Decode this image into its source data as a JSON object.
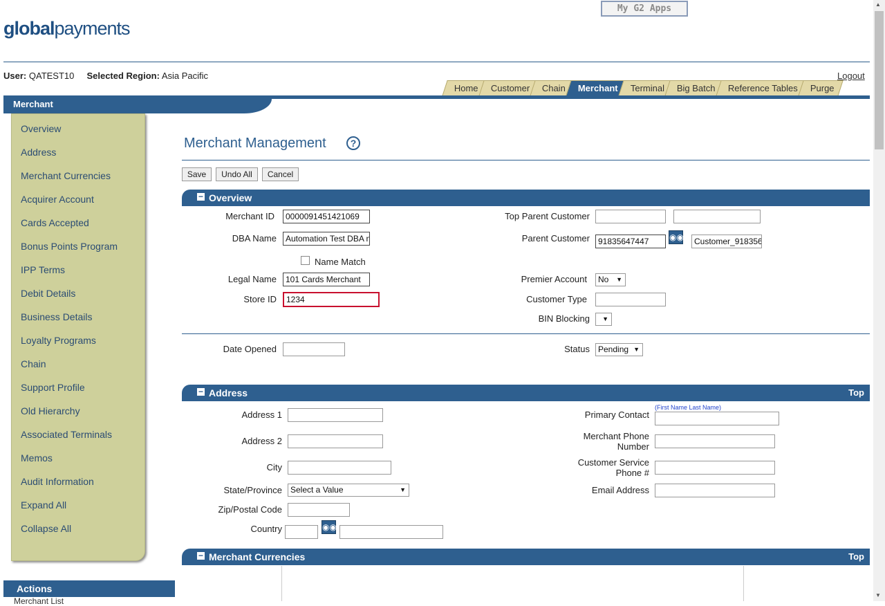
{
  "header": {
    "apps_button": "My G2 Apps",
    "logo_bold": "global",
    "logo_light": "payments",
    "user_label": "User:",
    "user_value": "QATEST10",
    "region_label": "Selected Region:",
    "region_value": "Asia Pacific",
    "logout": "Logout"
  },
  "tabs": [
    "Home",
    "Customer",
    "Chain",
    "Merchant",
    "Terminal",
    "Big Batch",
    "Reference Tables",
    "Purge"
  ],
  "active_tab": "Merchant",
  "subnav_title": "Merchant",
  "sidebar": {
    "items": [
      "Overview",
      "Address",
      "Merchant Currencies",
      "Acquirer Account",
      "Cards Accepted",
      "Bonus Points Program",
      "IPP Terms",
      "Debit Details",
      "Business Details",
      "Loyalty Programs",
      "Chain",
      "Support Profile",
      "Old Hierarchy",
      "Associated Terminals",
      "Memos",
      "Audit Information",
      "Expand All",
      "Collapse All"
    ]
  },
  "actions": {
    "title": "Actions",
    "first_item": "Merchant List"
  },
  "page": {
    "title": "Merchant Management",
    "help": "?",
    "buttons": {
      "save": "Save",
      "undo": "Undo All",
      "cancel": "Cancel"
    }
  },
  "overview": {
    "title": "Overview",
    "merchant_id_label": "Merchant ID",
    "merchant_id": "0000091451421069",
    "dba_label": "DBA Name",
    "dba": "Automation Test DBA n",
    "name_match_label": "Name Match",
    "legal_label": "Legal Name",
    "legal": "101 Cards Merchant",
    "store_label": "Store ID",
    "store": "1234",
    "top_parent_label": "Top Parent Customer",
    "top_parent": "",
    "top_parent_name": "",
    "parent_label": "Parent Customer",
    "parent": "91835647447",
    "parent_name": "Customer_918356",
    "premier_label": "Premier Account",
    "premier": "No",
    "customer_type_label": "Customer Type",
    "customer_type": "",
    "bin_label": "BIN Blocking",
    "bin": "",
    "date_opened_label": "Date Opened",
    "date_opened": "",
    "status_label": "Status",
    "status": "Pending"
  },
  "address": {
    "title": "Address",
    "top": "Top",
    "address1_label": "Address 1",
    "address1": "",
    "address2_label": "Address 2",
    "address2": "",
    "city_label": "City",
    "city": "",
    "state_label": "State/Province",
    "state": "Select a Value",
    "zip_label": "Zip/Postal Code",
    "zip": "",
    "country_label": "Country",
    "country_code": "",
    "country_name": "",
    "primary_contact_label": "Primary Contact",
    "primary_contact_hint": "(First Name Last Name)",
    "primary_contact": "",
    "merchant_phone_label_1": "Merchant Phone",
    "merchant_phone_label_2": "Number",
    "merchant_phone": "",
    "cs_phone_label_1": "Customer Service",
    "cs_phone_label_2": "Phone #",
    "cs_phone": "",
    "email_label": "Email Address",
    "email": ""
  },
  "currencies": {
    "title": "Merchant Currencies",
    "top": "Top"
  },
  "colors": {
    "brand_blue": "#2e5f8f",
    "sidebar_bg": "#ced09b",
    "tab_bg": "#e3d9a8",
    "focus_border": "#c8102e"
  },
  "icons": {
    "help": "help-icon",
    "lookup": "binoculars-icon",
    "collapse": "minus-icon"
  }
}
